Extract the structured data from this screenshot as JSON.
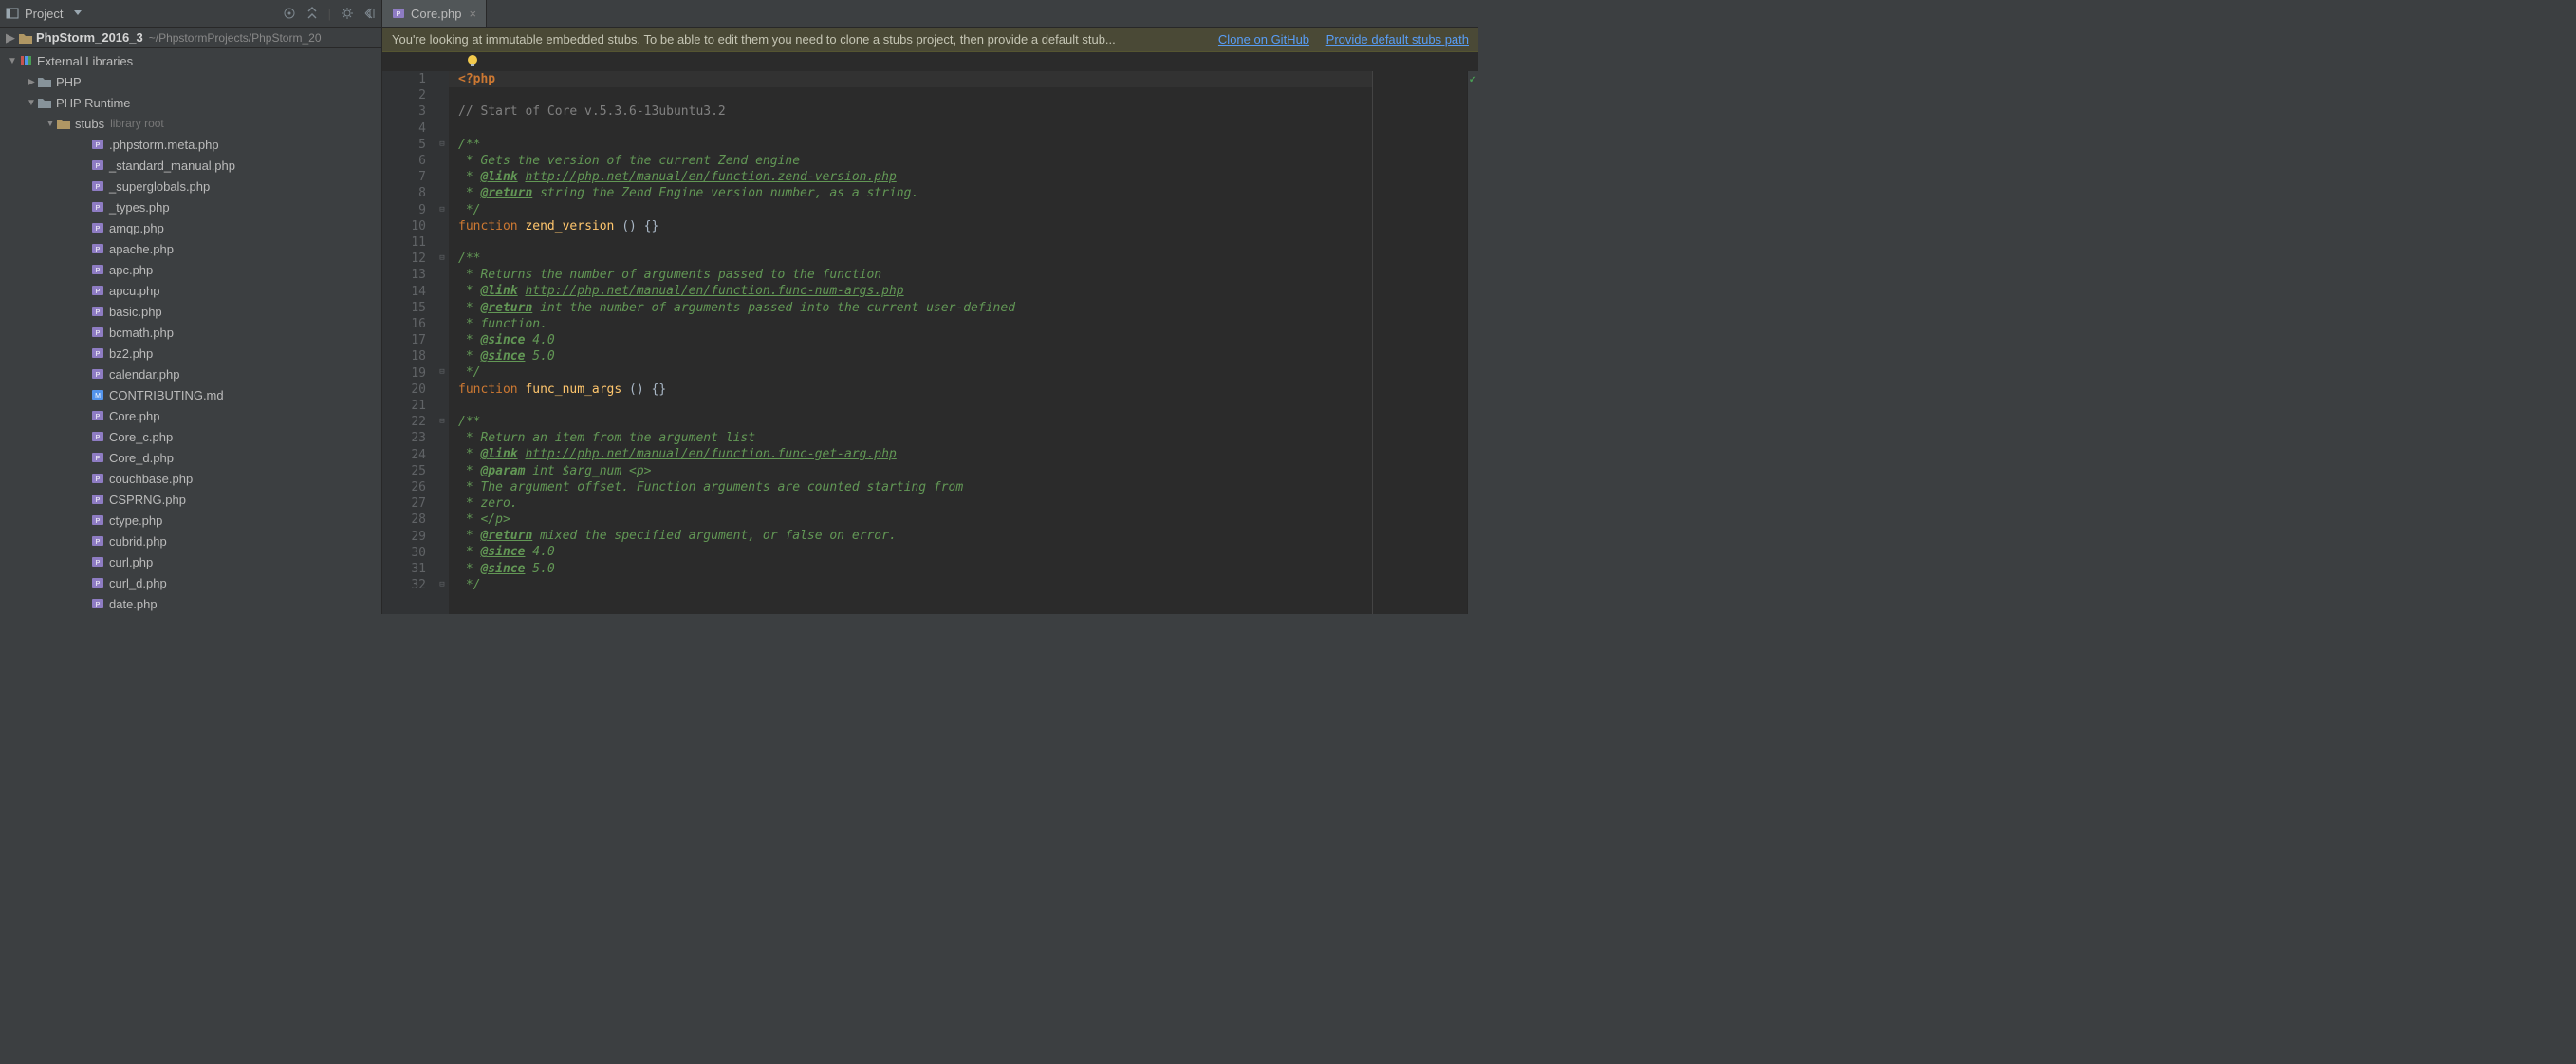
{
  "toolbar": {
    "project_label": "Project"
  },
  "tabs": [
    {
      "label": "Core.php"
    }
  ],
  "breadcrumb": {
    "project": "PhpStorm_2016_3",
    "path": "~/PhpstormProjects/PhpStorm_20"
  },
  "tree": {
    "external_libraries": "External Libraries",
    "php": "PHP",
    "php_runtime": "PHP Runtime",
    "stubs": "stubs",
    "stubs_extra": "library root",
    "files": [
      ".phpstorm.meta.php",
      "_standard_manual.php",
      "_superglobals.php",
      "_types.php",
      "amqp.php",
      "apache.php",
      "apc.php",
      "apcu.php",
      "basic.php",
      "bcmath.php",
      "bz2.php",
      "calendar.php",
      "CONTRIBUTING.md",
      "Core.php",
      "Core_c.php",
      "Core_d.php",
      "couchbase.php",
      "CSPRNG.php",
      "ctype.php",
      "cubrid.php",
      "curl.php",
      "curl_d.php",
      "date.php"
    ]
  },
  "banner": {
    "message": "You're looking at immutable embedded stubs. To be able to edit them you need to clone a stubs project, then provide a default stub...",
    "link1": "Clone on GitHub",
    "link2": "Provide default stubs path"
  },
  "code": {
    "line_count": 32,
    "fold_markers": {
      "5": "⊟",
      "9": "⊟",
      "12": "⊟",
      "19": "⊟",
      "22": "⊟",
      "32": "⊟"
    },
    "lines": [
      {
        "n": 1,
        "type": "phptag",
        "text": "<?php"
      },
      {
        "n": 2,
        "type": "blank",
        "text": ""
      },
      {
        "n": 3,
        "type": "comment",
        "text": "// Start of Core v.5.3.6-13ubuntu3.2"
      },
      {
        "n": 4,
        "type": "blank",
        "text": ""
      },
      {
        "n": 5,
        "type": "doc",
        "text": "/**"
      },
      {
        "n": 6,
        "type": "doc",
        "text": " * Gets the version of the current Zend engine"
      },
      {
        "n": 7,
        "type": "doclink",
        "tag": "@link",
        "rest": " http://php.net/manual/en/function.zend-version.php"
      },
      {
        "n": 8,
        "type": "doctag",
        "tag": "@return",
        "rest": " string the Zend Engine version number, as a string."
      },
      {
        "n": 9,
        "type": "doc",
        "text": " */"
      },
      {
        "n": 10,
        "type": "func",
        "kw": "function",
        "name": "zend_version",
        "rest": " () {}"
      },
      {
        "n": 11,
        "type": "blank",
        "text": ""
      },
      {
        "n": 12,
        "type": "doc",
        "text": "/**"
      },
      {
        "n": 13,
        "type": "doc",
        "text": " * Returns the number of arguments passed to the function"
      },
      {
        "n": 14,
        "type": "doclink",
        "tag": "@link",
        "rest": " http://php.net/manual/en/function.func-num-args.php"
      },
      {
        "n": 15,
        "type": "doctag",
        "tag": "@return",
        "rest": " int the number of arguments passed into the current user-defined"
      },
      {
        "n": 16,
        "type": "doc",
        "text": " * function."
      },
      {
        "n": 17,
        "type": "doctag",
        "tag": "@since",
        "rest": " 4.0"
      },
      {
        "n": 18,
        "type": "doctag",
        "tag": "@since",
        "rest": " 5.0"
      },
      {
        "n": 19,
        "type": "doc",
        "text": " */"
      },
      {
        "n": 20,
        "type": "func",
        "kw": "function",
        "name": "func_num_args",
        "rest": " () {}"
      },
      {
        "n": 21,
        "type": "blank",
        "text": ""
      },
      {
        "n": 22,
        "type": "doc",
        "text": "/**"
      },
      {
        "n": 23,
        "type": "doc",
        "text": " * Return an item from the argument list"
      },
      {
        "n": 24,
        "type": "doclink",
        "tag": "@link",
        "rest": " http://php.net/manual/en/function.func-get-arg.php"
      },
      {
        "n": 25,
        "type": "doctag",
        "tag": "@param",
        "rest": " int $arg_num <p>"
      },
      {
        "n": 26,
        "type": "doc",
        "text": " * The argument offset. Function arguments are counted starting from"
      },
      {
        "n": 27,
        "type": "doc",
        "text": " * zero."
      },
      {
        "n": 28,
        "type": "doc",
        "text": " * </p>"
      },
      {
        "n": 29,
        "type": "doctag",
        "tag": "@return",
        "rest": " mixed the specified argument, or false on error."
      },
      {
        "n": 30,
        "type": "doctag",
        "tag": "@since",
        "rest": " 4.0"
      },
      {
        "n": 31,
        "type": "doctag",
        "tag": "@since",
        "rest": " 5.0"
      },
      {
        "n": 32,
        "type": "doc",
        "text": " */"
      }
    ]
  }
}
